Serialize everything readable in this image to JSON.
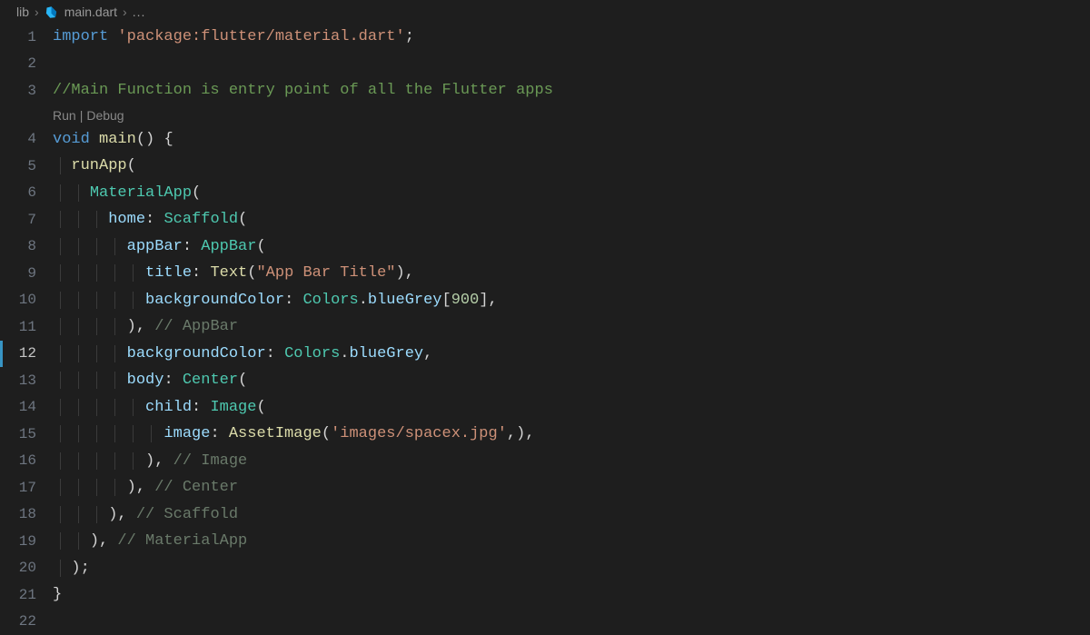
{
  "breadcrumb": {
    "folder": "lib",
    "file": "main.dart",
    "tail": "..."
  },
  "codelens": {
    "run": "Run",
    "debug": "Debug"
  },
  "gutter": {
    "l1": "1",
    "l2": "2",
    "l3": "3",
    "l4": "4",
    "l5": "5",
    "l6": "6",
    "l7": "7",
    "l8": "8",
    "l9": "9",
    "l10": "10",
    "l11": "11",
    "l12": "12",
    "l13": "13",
    "l14": "14",
    "l15": "15",
    "l16": "16",
    "l17": "17",
    "l18": "18",
    "l19": "19",
    "l20": "20",
    "l21": "21",
    "l22": "22"
  },
  "tok": {
    "import": "import",
    "pkg": "'package:flutter/material.dart'",
    "semi": ";",
    "comment_main": "//Main Function is entry point of all the Flutter apps",
    "void": "void",
    "main": "main",
    "parens_open": "(",
    "parens_close": ")",
    "brace_open": "{",
    "brace_close": "}",
    "runApp": "runApp",
    "MaterialApp": "MaterialApp",
    "home": "home",
    "colon": ":",
    "Scaffold": "Scaffold",
    "appBar": "appBar",
    "AppBar": "AppBar",
    "title": "title",
    "Text": "Text",
    "appbar_title_str": "\"App Bar Title\"",
    "comma": ",",
    "backgroundColor": "backgroundColor",
    "Colors": "Colors",
    "dot": ".",
    "blueGrey": "blueGrey",
    "br_open": "[",
    "br_close": "]",
    "num900": "900",
    "close_appbar": "// AppBar",
    "body": "body",
    "Center": "Center",
    "child": "child",
    "Image": "Image",
    "image": "image",
    "AssetImage": "AssetImage",
    "asset_str": "'images/spacex.jpg'",
    "close_image": "// Image",
    "close_center": "// Center",
    "close_scaffold": "// Scaffold",
    "close_materialapp": "// MaterialApp",
    "space": " "
  }
}
